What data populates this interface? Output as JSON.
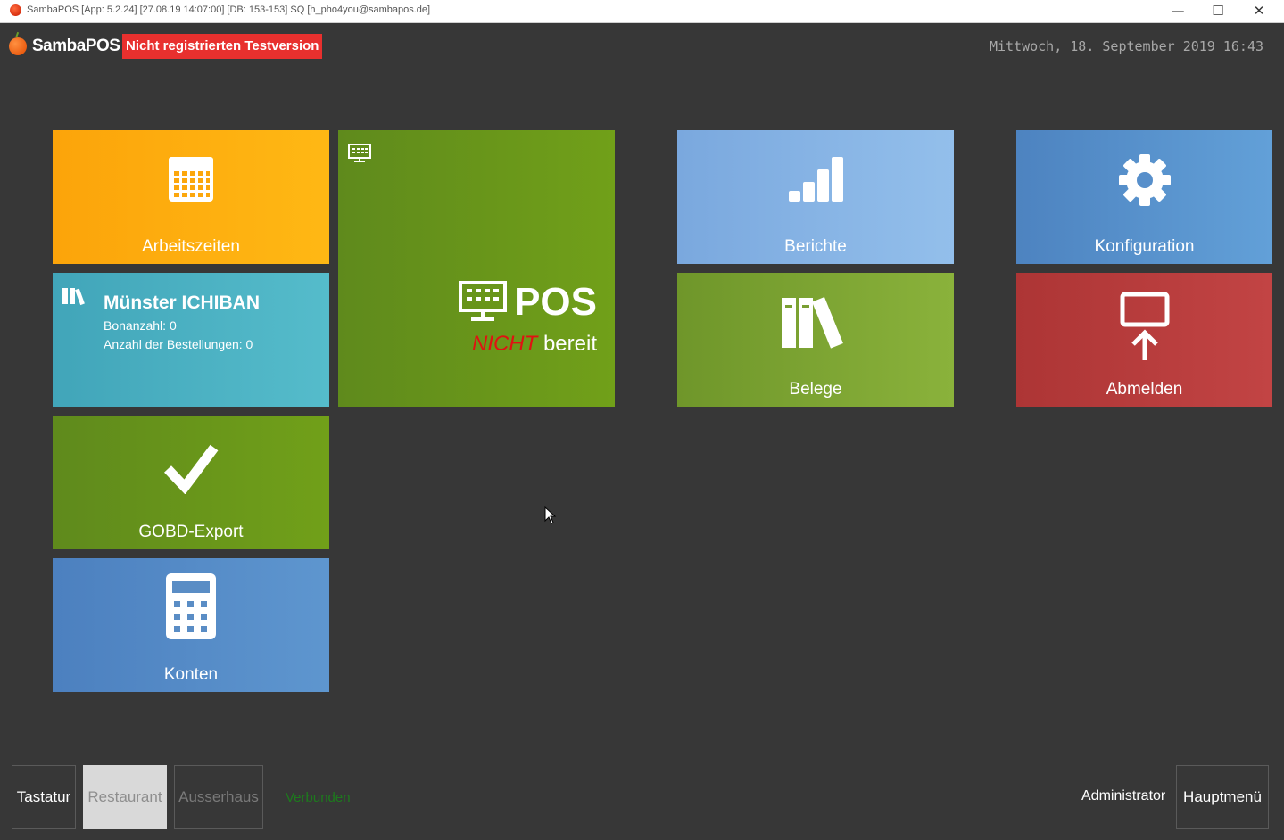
{
  "window": {
    "title": "SambaPOS [App: 5.2.24] [27.08.19 14:07:00] [DB: 153-153] SQ [h_pho4you@sambapos.de]",
    "minimize": "—",
    "maximize": "☐",
    "close": "✕"
  },
  "header": {
    "logo_text": "SambaPOS",
    "trial_badge": "Nicht registrierten Testversion",
    "datetime": "Mittwoch, 18. September 2019 16:43"
  },
  "tiles": {
    "arbeitszeiten": "Arbeitszeiten",
    "pos_label": "POS",
    "pos_status_not": "NICHT",
    "pos_status_ready": "bereit",
    "berichte": "Berichte",
    "konfiguration": "Konfiguration",
    "restaurant_title": "Münster ICHIBAN",
    "restaurant_bon": "Bonanzahl: 0",
    "restaurant_orders": "Anzahl der Bestellungen: 0",
    "belege": "Belege",
    "abmelden": "Abmelden",
    "gobd": "GOBD-Export",
    "konten": "Konten"
  },
  "colors": {
    "orange": "#fda90c",
    "green": "#6e9a22",
    "teal": "#4aaebe",
    "blue": "#5a8dc5",
    "light_blue": "#86b1e2",
    "red": "#b83b3b",
    "status_not_ready": "#e01212",
    "connected": "#1d7a1d"
  },
  "footer": {
    "tastatur": "Tastatur",
    "restaurant": "Restaurant",
    "ausserhaus": "Ausserhaus",
    "status": "Verbunden",
    "user": "Administrator",
    "hauptmenu": "Hauptmenü"
  }
}
